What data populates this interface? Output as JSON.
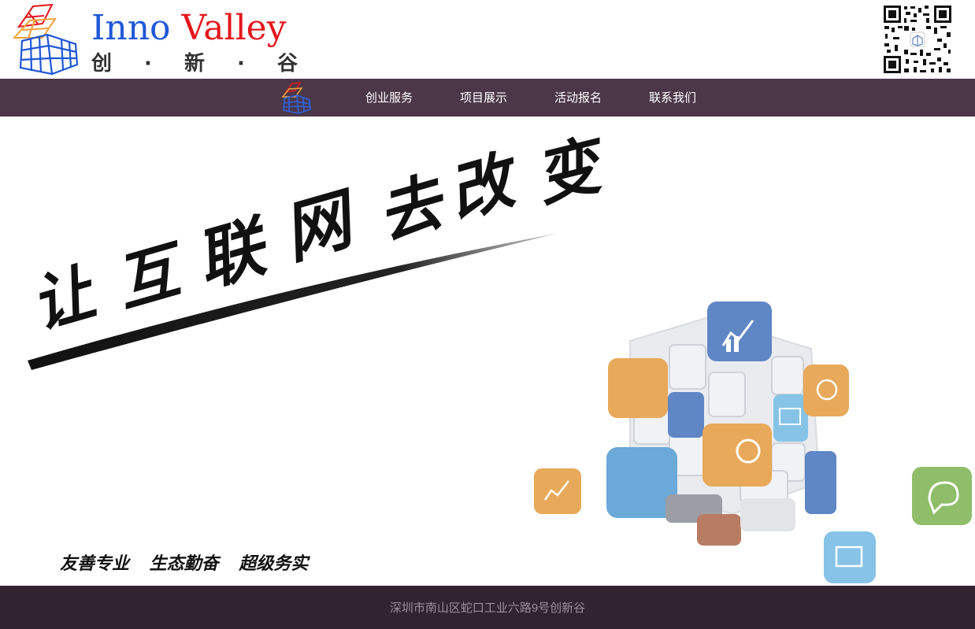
{
  "header": {
    "brand_en_part1": "Inno",
    "brand_en_part2": "Valley",
    "brand_cn": [
      "创",
      "·",
      "新",
      "·",
      "谷"
    ]
  },
  "nav": {
    "items": [
      {
        "label": "创业服务"
      },
      {
        "label": "项目展示"
      },
      {
        "label": "活动报名"
      },
      {
        "label": "联系我们"
      }
    ]
  },
  "banner": {
    "slogan": [
      "让",
      "互",
      "联",
      "网",
      "去",
      "改",
      "变"
    ],
    "motto": "友善专业 生态勤奋 超级务实"
  },
  "footer": {
    "address": "深圳市南山区蛇口工业六路9号创新谷"
  },
  "colors": {
    "nav_bg": "#4b3748",
    "footer_bg": "#322330",
    "brand_blue": "#1f57d6",
    "brand_red": "#e4161c",
    "cube_blue": "#5f86c5",
    "cube_orange": "#e8a95a",
    "cube_lightblue": "#86c3e6",
    "cube_green": "#8fbd6a"
  },
  "icons": [
    "rubik-cube-logo-icon",
    "qr-code-icon",
    "cube-cluster-illustration"
  ]
}
